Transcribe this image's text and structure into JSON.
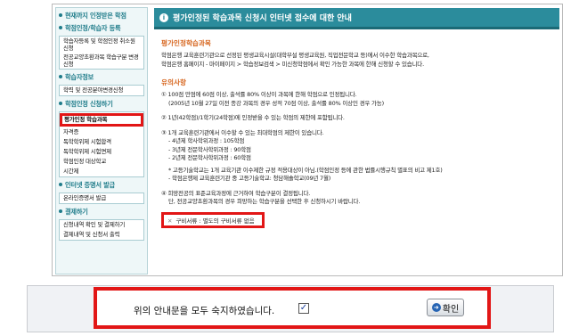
{
  "sidebar": {
    "sections": [
      {
        "title": "현재까지 인정받은 학점"
      },
      {
        "title": "학점인정/학습자 등록"
      },
      {
        "title": "학습자정보"
      },
      {
        "title": "학점인정 신청하기"
      },
      {
        "title": "인터넷 증명서 발급"
      },
      {
        "title": "결제하기"
      }
    ],
    "items": {
      "learner_reg_cancel": "학습자등록 및 학점인정 취소원 신청",
      "major_change": "전공교양초환과목 학습구분 변경 신청",
      "major_field_change": "학력 및 전공분야변경신청",
      "eval_course": "평가인정 학습과목",
      "self_study": "자격증",
      "indep_test": "독학학위제 시험합격",
      "indep_exempt": "독학학위제 시험면제",
      "recognized_target": "학점인정 대상학교",
      "hours": "시간제",
      "online_cert": "온라인증명서 발급",
      "pay_detail": "신청내역 확인 및 결제하기",
      "pay_output": "결제내역 및 신청서 출력"
    }
  },
  "content": {
    "title": "평가인정된 학습과목 신청시 인터넷 접수에 대한 안내",
    "section1_heading": "평가인정학습과목",
    "intro_lines": [
      "학점은행 교육훈련기관으로 선정된 평생교육시설(대학부설 평생교육원, 직업전문학교 등)에서 이수한 학습과목으로,",
      "학점은행 홈페이지 - 마이페이지 > 학습정보검색 > 미신청학점에서 확인 가능한 과목에 한해 신청할 수 있습니다."
    ],
    "section2_heading": "유의사항",
    "notes": {
      "n1": "① 100점 만점에 60점 이상, 출석률 80% 이상이 과목에 한해 학점으로 인정됩니다.",
      "n1_sub": "(2005년 10월 27일 이전 종강 과목의 경우 성적 70점 이상, 출석률 80% 이상인 경우 가능)",
      "n2": "② 1년(42학점)/1학기(24학점)에 인정받을 수 있는 학점의 제한에 포함됩니다.",
      "n3": "③ 1개 교육훈련기관에서 이수할 수 있는 최대학점의 제한이 있습니다.",
      "n3_a": "- 4년제 학사학위과정 : 105학점",
      "n3_b": "- 3년제 전문학사학위과정 : 90학점",
      "n3_c": "- 2년제 전문학사학위과정 : 60학점",
      "n3_d": "* 고등기술학교는 1개 교육기관 이수제한 규정 적용대상이 아님.(학점인정 등에 관한 법률시행규칙 별표의 비고 제1호)",
      "n3_e": "- 학점은행제 교육훈련기관 중 고등기술학교: 청담해솔학교(09년 7월)",
      "n4": "④ 희망전공의 표준교육과정에 근거하여 학습구분이 결정됩니다.",
      "n4_sub": "단, 전공교양초환과목의 경우 희망하는 학습구분을 선택한 후 신청하시기 바랍니다."
    },
    "notice": "구비서류 : 별도의 구비서류 없음"
  },
  "confirm": {
    "agree_label": "위의 안내문을 모두 숙지하였습니다.",
    "checked_mark": "✓",
    "ok_label": "확인"
  }
}
